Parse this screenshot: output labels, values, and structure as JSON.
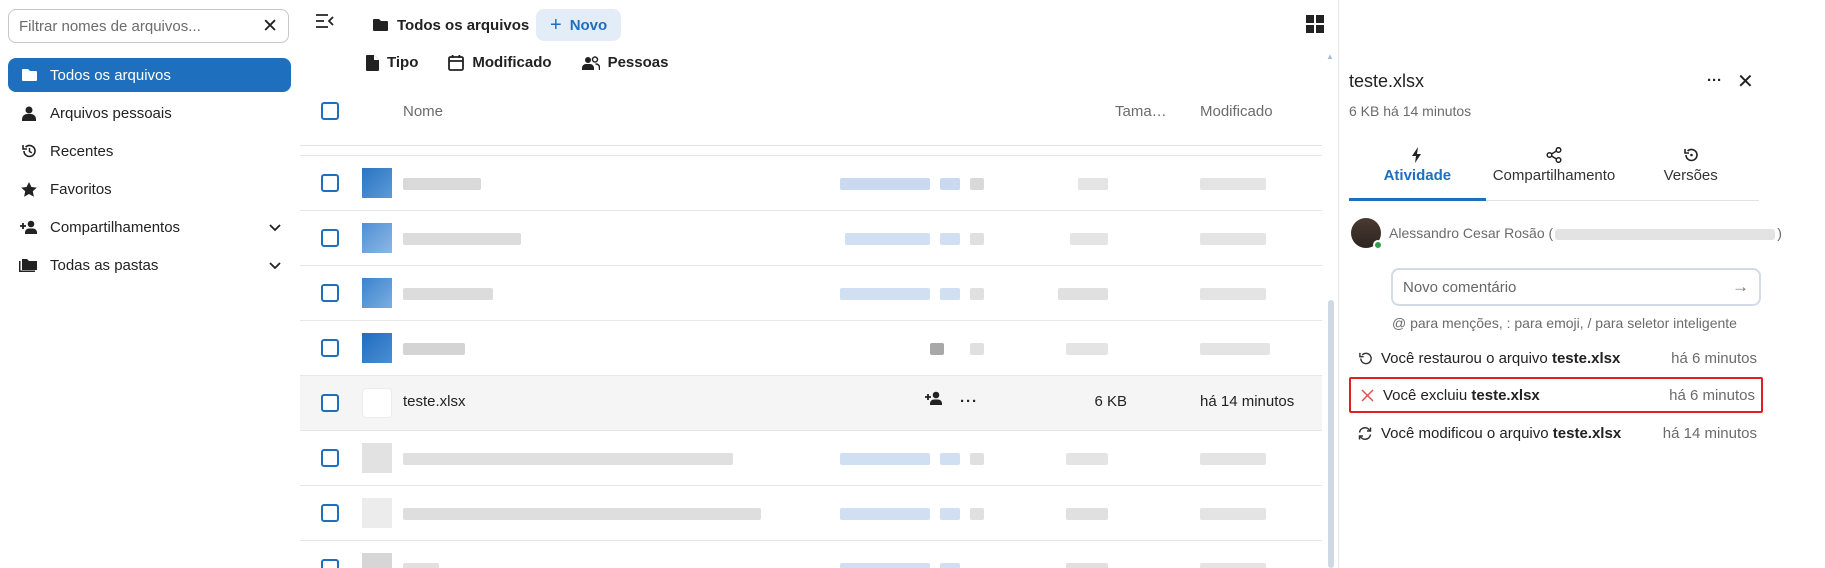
{
  "nav": {
    "filter_placeholder": "Filtrar nomes de arquivos...",
    "items": [
      {
        "label": "Todos os arquivos",
        "icon": "folder-icon"
      },
      {
        "label": "Arquivos pessoais",
        "icon": "person-icon"
      },
      {
        "label": "Recentes",
        "icon": "history-icon"
      },
      {
        "label": "Favoritos",
        "icon": "star-icon"
      },
      {
        "label": "Compartilhamentos",
        "icon": "share-add-icon"
      },
      {
        "label": "Todas as pastas",
        "icon": "folders-icon"
      }
    ]
  },
  "header": {
    "breadcrumb": "Todos os arquivos",
    "new_button": "Novo"
  },
  "filters": {
    "type": "Tipo",
    "modified": "Modificado",
    "people": "Pessoas"
  },
  "table": {
    "col_name": "Nome",
    "col_size": "Tama…",
    "col_modified": "Modificado",
    "visible_row": {
      "name": "teste.xlsx",
      "size": "6 KB",
      "modified": "há 14 minutos"
    }
  },
  "sidebar": {
    "title": "teste.xlsx",
    "subtitle": "6 KB há 14 minutos",
    "tabs": [
      {
        "label": "Atividade"
      },
      {
        "label": "Compartilhamento"
      },
      {
        "label": "Versões"
      }
    ],
    "user_name": "Alessandro Cesar Rosão (",
    "user_name_end": ")",
    "comment_placeholder": "Novo comentário",
    "hint": "@ para menções, : para emoji, / para seletor inteligente",
    "activities": [
      {
        "prefix": "Você restaurou o arquivo ",
        "file": "teste.xlsx",
        "time": "há 6 minutos"
      },
      {
        "prefix": "Você excluiu ",
        "file": "teste.xlsx",
        "time": "há 6 minutos"
      },
      {
        "prefix": "Você modificou o arquivo ",
        "file": "teste.xlsx",
        "time": "há 14 minutos"
      }
    ]
  },
  "colors": {
    "accent": "#1e6fbd",
    "highlight_border": "#e02020"
  }
}
